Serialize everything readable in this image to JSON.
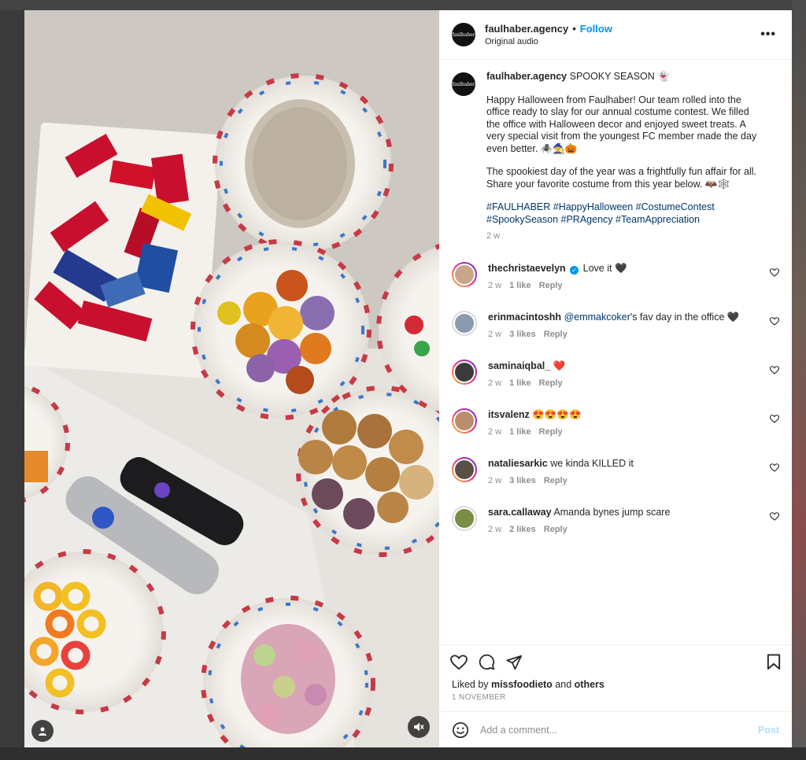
{
  "post": {
    "username": "faulhaber.agency",
    "separator": "•",
    "follow_label": "Follow",
    "audio": "Original audio",
    "more_label": "•••",
    "logo_text": "faulhaber"
  },
  "caption": {
    "username": "faulhaber.agency",
    "headline": "SPOOKY SEASON 👻",
    "paragraph1": "Happy Halloween from Faulhaber! Our team rolled into the office ready to slay for our annual costume contest. We filled the office with Halloween decor and enjoyed sweet treats. A very special visit from the youngest FC member made the day even better. 🕷️🧙🎃",
    "paragraph2": "The spookiest day of the year was a frightfully fun affair for all. Share your favorite costume from this year below. 🦇🕸️",
    "hashtags": "#FAULHABER #HappyHalloween #CostumeContest #SpookySeason #PRAgency #TeamAppreciation",
    "time": "2 w"
  },
  "comments": [
    {
      "username": "thechristaevelyn",
      "verified": true,
      "text": "Love it 🖤",
      "time": "2 w",
      "likes": "1 like",
      "reply": "Reply",
      "color": "#c9a58c"
    },
    {
      "username": "erinmacintoshh",
      "mention": "@emmakcoker",
      "text": "'s fav day in the office 🖤",
      "time": "2 w",
      "likes": "3 likes",
      "reply": "Reply",
      "color": "#8a9bb0"
    },
    {
      "username": "saminaiqbal_",
      "text": "❤️",
      "time": "2 w",
      "likes": "1 like",
      "reply": "Reply",
      "color": "#3b3b3b"
    },
    {
      "username": "itsvalenz",
      "text": "😍😍😍😍",
      "time": "2 w",
      "likes": "1 like",
      "reply": "Reply",
      "color": "#b98d6d"
    },
    {
      "username": "nataliesarkic",
      "text": "we kinda KILLED it",
      "time": "2 w",
      "likes": "3 likes",
      "reply": "Reply",
      "color": "#5a5046"
    },
    {
      "username": "sara.callaway",
      "text": "Amanda bynes jump scare",
      "time": "2 w",
      "likes": "2 likes",
      "reply": "Reply",
      "color": "#7c8d45"
    }
  ],
  "likes": {
    "prefix": "Liked by ",
    "user": "missfoodieto",
    "mid": " and ",
    "others": "others"
  },
  "date": "1 NOVEMBER",
  "add_comment": {
    "placeholder": "Add a comment...",
    "post_label": "Post"
  },
  "colors": {
    "accent": "#0095f6",
    "link": "#00376b",
    "muted": "#8e8e8e"
  }
}
